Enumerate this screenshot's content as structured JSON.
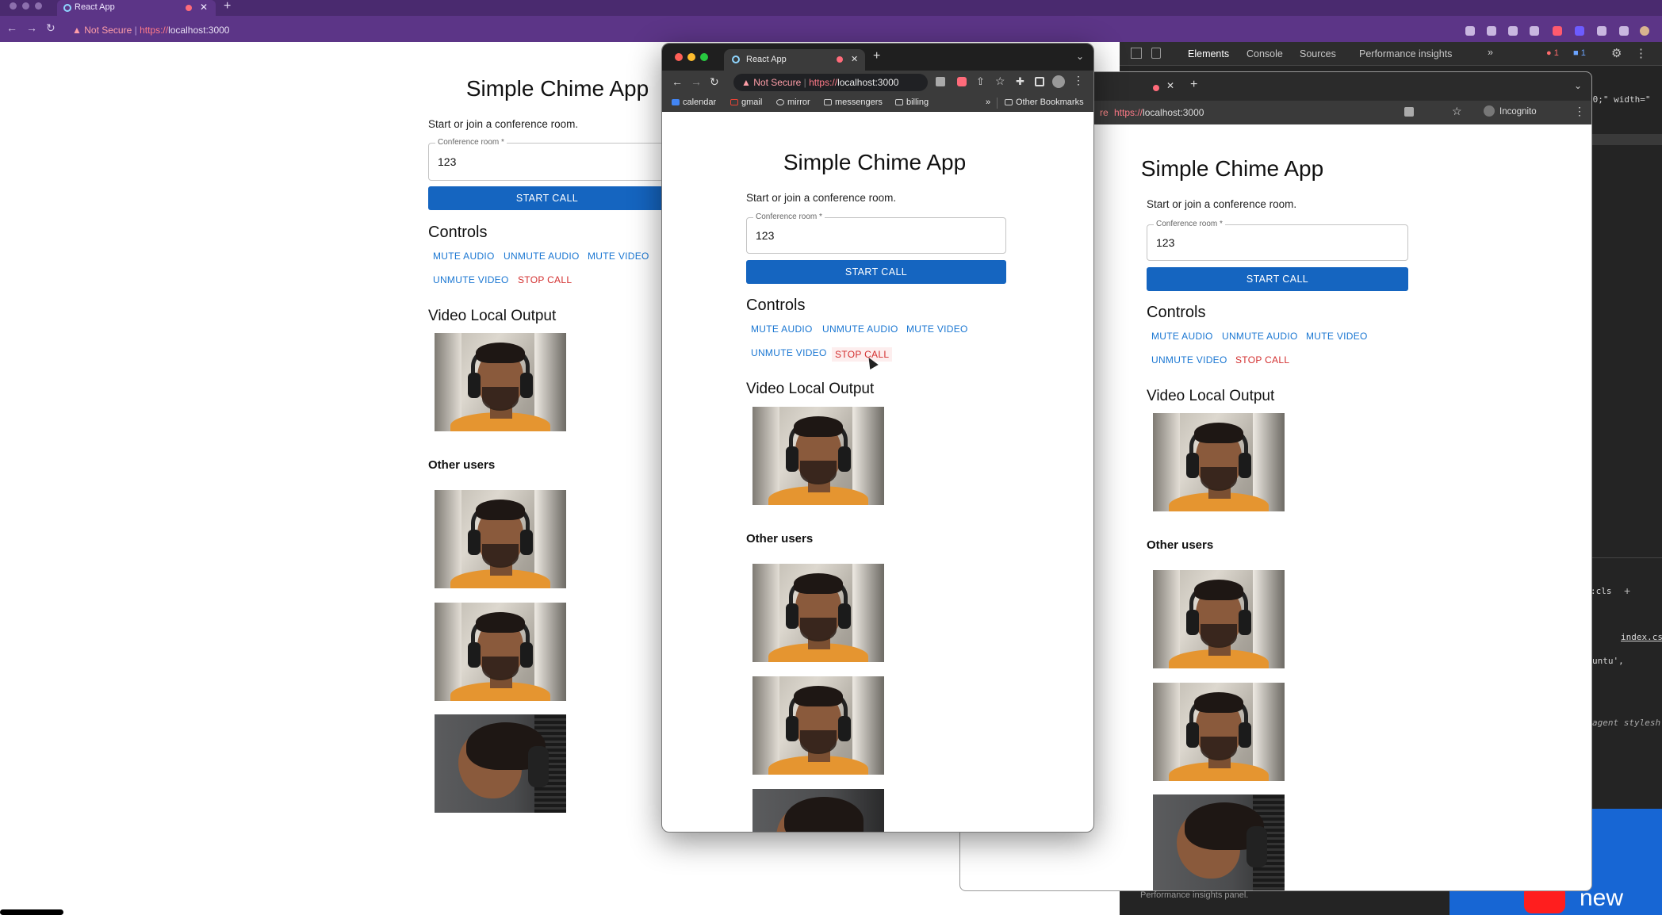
{
  "browser": {
    "tab_title": "React App",
    "security_label": "Not Secure",
    "url_proto": "https://",
    "url_host": "localhost:3000"
  },
  "app": {
    "title": "Simple Chime App",
    "subtitle": "Start or join a conference room.",
    "room_label": "Conference room *",
    "room_value": "123",
    "start_button": "START CALL",
    "controls_heading": "Controls",
    "controls": {
      "mute_audio": "MUTE AUDIO",
      "unmute_audio": "UNMUTE AUDIO",
      "mute_video": "MUTE VIDEO",
      "unmute_video": "UNMUTE VIDEO",
      "stop_call": "STOP CALL"
    },
    "local_heading": "Video Local Output",
    "others_heading": "Other users"
  },
  "popup": {
    "bookmarks": [
      "calendar",
      "gmail",
      "mirror",
      "messengers",
      "billing"
    ],
    "other_bookmarks": "Other Bookmarks",
    "more": "»"
  },
  "incognito": {
    "label": "Incognito",
    "url_prefix": "re"
  },
  "devtools": {
    "tabs": [
      "Elements",
      "Console",
      "Sources",
      "Performance insights"
    ],
    "more": "»",
    "errors_count": "1",
    "messages_count": "1",
    "code_lines": {
      "line1": "00;\" width=\"",
      "cls": ":cls",
      "file": "index.cs",
      "font": "untu',",
      "ua": "agent stylesh"
    },
    "footer_text": "Performance insights panel."
  },
  "banner": {
    "text": "new"
  },
  "colors": {
    "primary": "#1565c0",
    "control_blue": "#1976d2",
    "stop_red": "#d32f2f",
    "browser_purple": "#5c3587"
  }
}
